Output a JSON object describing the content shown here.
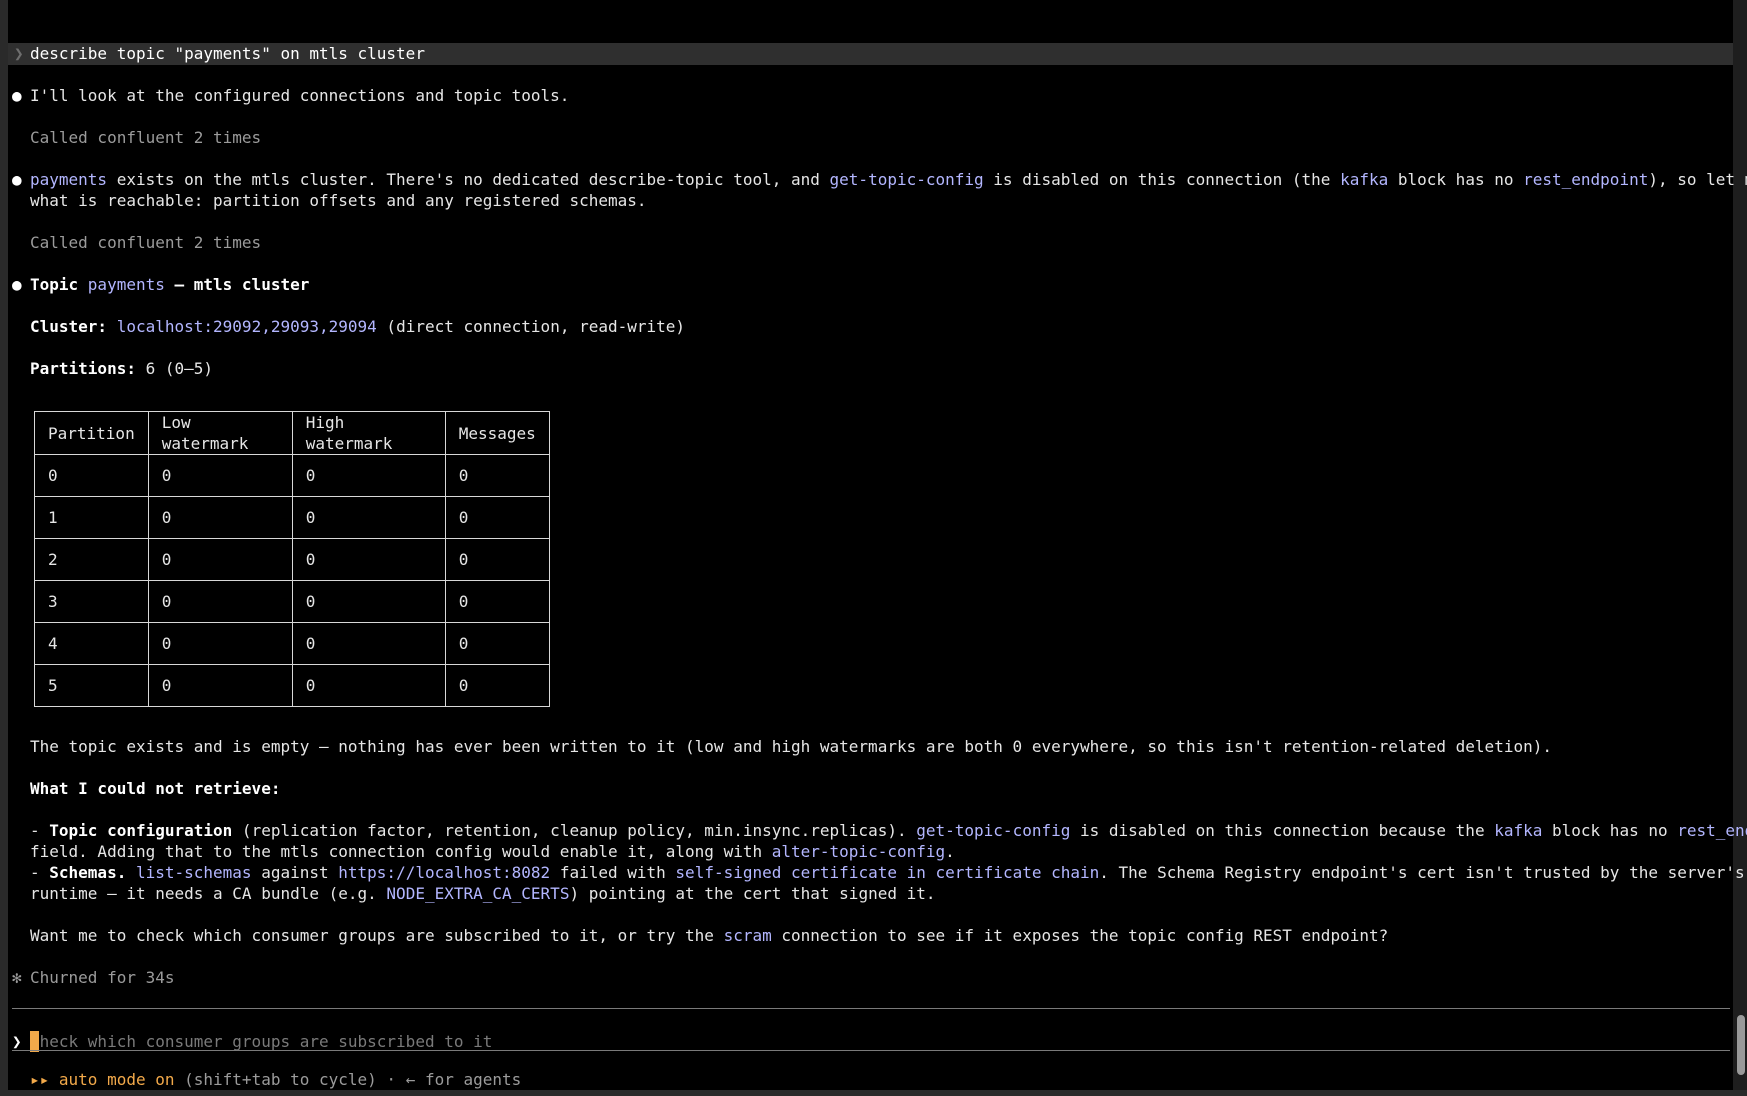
{
  "session": {
    "user_prompt": "describe topic \"payments\" on mtls cluster"
  },
  "messages": {
    "m1": "I'll look at the configured connections and topic tools.",
    "tool_call_1": "Called confluent 2 times",
    "m2": {
      "t1": "payments",
      "t2": " exists on the mtls cluster. There's no dedicated describe-topic tool, and ",
      "t3": "get-topic-config",
      "t4": " is disabled on this connection (the ",
      "t5": "kafka",
      "t6": " block has no ",
      "t7": "rest_endpoint",
      "t8": "), so let me gather",
      "line2": "what is reachable: partition offsets and any registered schemas."
    },
    "tool_call_2": "Called confluent 2 times",
    "heading": {
      "prefix": "Topic ",
      "topic": "payments",
      "suffix": " — mtls cluster"
    },
    "cluster": {
      "label": "Cluster:",
      "value": "localhost:29092,29093,29094",
      "note": " (direct connection, read-write)"
    },
    "partitions": {
      "label": "Partitions:",
      "value": " 6 (0–5)"
    },
    "table": {
      "headers": [
        "Partition",
        "Low watermark",
        "High watermark",
        "Messages"
      ],
      "rows": [
        [
          "0",
          "0",
          "0",
          "0"
        ],
        [
          "1",
          "0",
          "0",
          "0"
        ],
        [
          "2",
          "0",
          "0",
          "0"
        ],
        [
          "3",
          "0",
          "0",
          "0"
        ],
        [
          "4",
          "0",
          "0",
          "0"
        ],
        [
          "5",
          "0",
          "0",
          "0"
        ]
      ]
    },
    "summary": "The topic exists and is empty — nothing has ever been written to it (low and high watermarks are both 0 everywhere, so this isn't retention-related deletion).",
    "not_retrieved_heading": "What I could not retrieve:",
    "item1": {
      "dash": "- ",
      "title": "Topic configuration",
      "t1": " (replication factor, retention, cleanup policy, min.insync.replicas). ",
      "t2": "get-topic-config",
      "t3": " is disabled on this connection because the ",
      "t4": "kafka",
      "t5": " block has no ",
      "t6": "rest_endpoint",
      "line2": "field. Adding that to the mtls connection config would enable it, along with ",
      "t7": "alter-topic-config",
      "t8": "."
    },
    "item2": {
      "dash": "- ",
      "title": "Schemas.",
      "t1": " ",
      "t2": "list-schemas",
      "t3": " against ",
      "t4": "https://localhost:8082",
      "t5": " failed with ",
      "t6": "self-signed certificate in certificate chain",
      "t7": ". The Schema Registry endpoint's cert isn't trusted by the server's Node",
      "line2a": "runtime — it needs a CA bundle (e.g. ",
      "t8": "NODE_EXTRA_CA_CERTS",
      "line2b": ") pointing at the cert that signed it."
    },
    "followup": {
      "t1": "Want me to check which consumer groups are subscribed to it, or try the ",
      "t2": "scram",
      "t3": " connection to see if it exposes the topic config REST endpoint?"
    },
    "status": "Churned for 34s"
  },
  "input": {
    "placeholder": "check which consumer groups are subscribed to it"
  },
  "footer": {
    "mode_icon": "▸▸",
    "mode": "auto mode on",
    "hint": " (shift+tab to cycle) · ← for agents"
  },
  "glyphs": {
    "bullet": "●",
    "caret": "❯",
    "star": "✻"
  },
  "colors": {
    "accent": "#f2a94a",
    "link": "#b3b6ff",
    "dim": "#9b9b9b"
  }
}
